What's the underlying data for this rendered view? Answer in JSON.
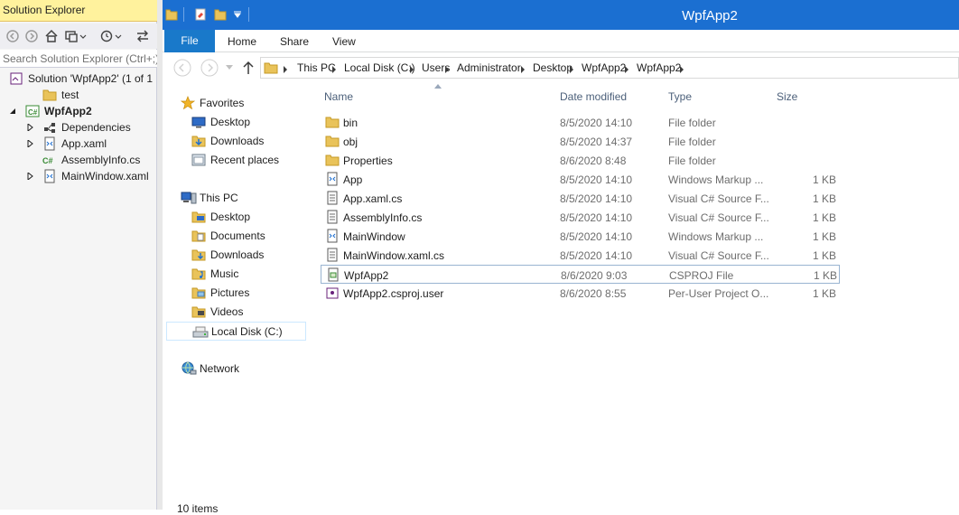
{
  "solution_explorer": {
    "title": "Solution Explorer",
    "search_placeholder": "Search Solution Explorer (Ctrl+;)",
    "tree": [
      {
        "label": "Solution 'WpfApp2' (1 of 1",
        "icon": "solution-icon",
        "level": 0,
        "expander": "none",
        "bold": false
      },
      {
        "label": "test",
        "icon": "folder-icon",
        "level": 1,
        "expander": "none",
        "bold": false
      },
      {
        "label": "WpfApp2",
        "icon": "csharp-project-icon",
        "level": 0,
        "expander": "expanded",
        "bold": true
      },
      {
        "label": "Dependencies",
        "icon": "dependencies-icon",
        "level": 1,
        "expander": "collapsed",
        "bold": false
      },
      {
        "label": "App.xaml",
        "icon": "xaml-file-icon",
        "level": 1,
        "expander": "collapsed",
        "bold": false
      },
      {
        "label": "AssemblyInfo.cs",
        "icon": "csharp-file-icon",
        "level": 1,
        "expander": "none",
        "bold": false
      },
      {
        "label": "MainWindow.xaml",
        "icon": "xaml-file-icon",
        "level": 1,
        "expander": "collapsed",
        "bold": false
      }
    ]
  },
  "explorer": {
    "window_title": "WpfApp2",
    "ribbon": {
      "file": "File",
      "tabs": [
        "Home",
        "Share",
        "View"
      ]
    },
    "address": [
      "This PC",
      "Local Disk (C:)",
      "Users",
      "Administrator",
      "Desktop",
      "WpfApp2",
      "WpfApp2"
    ],
    "nav": [
      {
        "label": "Favorites",
        "icon": "star-icon",
        "indent": 0,
        "gap_before": false
      },
      {
        "label": "Desktop",
        "icon": "desktop-icon",
        "indent": 1,
        "gap_before": false
      },
      {
        "label": "Downloads",
        "icon": "downloads-icon",
        "indent": 1,
        "gap_before": false
      },
      {
        "label": "Recent places",
        "icon": "recent-places-icon",
        "indent": 1,
        "gap_before": false
      },
      {
        "label": "This PC",
        "icon": "computer-icon",
        "indent": 0,
        "gap_before": true
      },
      {
        "label": "Desktop",
        "icon": "desktop-folder-icon",
        "indent": 1,
        "gap_before": false
      },
      {
        "label": "Documents",
        "icon": "documents-folder-icon",
        "indent": 1,
        "gap_before": false
      },
      {
        "label": "Downloads",
        "icon": "downloads-folder-icon",
        "indent": 1,
        "gap_before": false
      },
      {
        "label": "Music",
        "icon": "music-folder-icon",
        "indent": 1,
        "gap_before": false
      },
      {
        "label": "Pictures",
        "icon": "pictures-folder-icon",
        "indent": 1,
        "gap_before": false
      },
      {
        "label": "Videos",
        "icon": "videos-folder-icon",
        "indent": 1,
        "gap_before": false
      },
      {
        "label": "Local Disk (C:)",
        "icon": "drive-icon",
        "indent": 1,
        "gap_before": false,
        "selected": true
      },
      {
        "label": "Network",
        "icon": "network-icon",
        "indent": 0,
        "gap_before": true
      }
    ],
    "columns": {
      "name": "Name",
      "date": "Date modified",
      "type": "Type",
      "size": "Size"
    },
    "files": [
      {
        "name": "bin",
        "date": "8/5/2020 14:10",
        "type": "File folder",
        "size": "",
        "icon": "folder-icon"
      },
      {
        "name": "obj",
        "date": "8/5/2020 14:37",
        "type": "File folder",
        "size": "",
        "icon": "folder-icon"
      },
      {
        "name": "Properties",
        "date": "8/6/2020 8:48",
        "type": "File folder",
        "size": "",
        "icon": "folder-icon"
      },
      {
        "name": "App",
        "date": "8/5/2020 14:10",
        "type": "Windows Markup ...",
        "size": "1 KB",
        "icon": "xaml-file-icon"
      },
      {
        "name": "App.xaml.cs",
        "date": "8/5/2020 14:10",
        "type": "Visual C# Source F...",
        "size": "1 KB",
        "icon": "text-file-icon"
      },
      {
        "name": "AssemblyInfo.cs",
        "date": "8/5/2020 14:10",
        "type": "Visual C# Source F...",
        "size": "1 KB",
        "icon": "text-file-icon"
      },
      {
        "name": "MainWindow",
        "date": "8/5/2020 14:10",
        "type": "Windows Markup ...",
        "size": "1 KB",
        "icon": "xaml-file-icon"
      },
      {
        "name": "MainWindow.xaml.cs",
        "date": "8/5/2020 14:10",
        "type": "Visual C# Source F...",
        "size": "1 KB",
        "icon": "text-file-icon"
      },
      {
        "name": "WpfApp2",
        "date": "8/6/2020 9:03",
        "type": "CSPROJ File",
        "size": "1 KB",
        "icon": "csproj-file-icon",
        "selected": true
      },
      {
        "name": "WpfApp2.csproj.user",
        "date": "8/6/2020 8:55",
        "type": "Per-User Project O...",
        "size": "1 KB",
        "icon": "user-project-file-icon"
      }
    ],
    "status": "10 items"
  }
}
